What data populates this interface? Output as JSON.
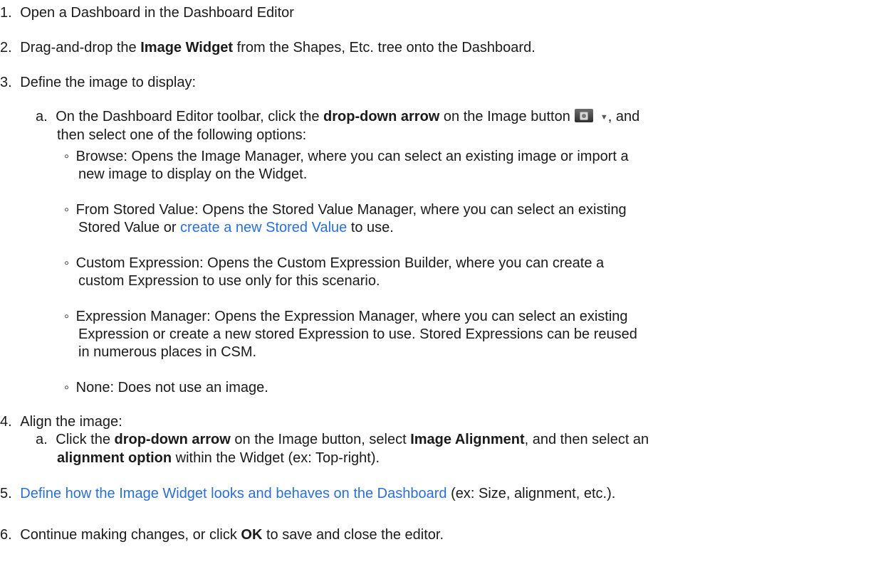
{
  "steps": {
    "s1": {
      "num": "1.",
      "text": "Open a Dashboard in the Dashboard Editor"
    },
    "s2": {
      "num": "2.",
      "pre": "Drag-and-drop the ",
      "bold": "Image Widget",
      "post": " from the Shapes, Etc. tree onto the Dashboard."
    },
    "s3": {
      "num": "3.",
      "text": "Define the image to display:",
      "a": {
        "letter": "a.",
        "pre": "On the Dashboard Editor toolbar, click the ",
        "bold": "drop-down arrow",
        "mid": " on the Image button",
        "post": ", and",
        "line2": "then select one of the following options:",
        "icon": "camera-icon",
        "arrow_icon": "dropdown-arrow-icon",
        "options": {
          "browse": {
            "line1": "Browse: Opens the Image Manager, where you can select an existing image or import a",
            "line2": "new image to display on the Widget."
          },
          "stored": {
            "line1": "From Stored Value: Opens the Stored Value Manager, where you can select an existing",
            "line2_pre": "Stored Value or ",
            "line2_link": "create a new Stored Value",
            "line2_post": " to use."
          },
          "custom": {
            "line1": "Custom Expression: Opens the Custom Expression Builder, where you can create a",
            "line2": "custom Expression to use only for this scenario."
          },
          "manager": {
            "line1": "Expression Manager: Opens the Expression Manager, where you can select an existing",
            "line2": "Expression or create a new stored Expression to use. Stored Expressions can be reused",
            "line3": "in numerous places in CSM."
          },
          "none": {
            "line1": "None: Does not use an image."
          }
        }
      }
    },
    "s4": {
      "num": "4.",
      "text": "Align the image:",
      "a": {
        "letter": "a.",
        "pre": "Click the ",
        "bold1": "drop-down arrow",
        "mid1": " on the Image button, select ",
        "bold2": "Image Alignment",
        "post1": ", and then select an",
        "bold3": "alignment option",
        "post2": " within the Widget (ex: Top-right)."
      }
    },
    "s5": {
      "num": "5.",
      "link": "Define how the Image Widget looks and behaves on the Dashboard",
      "post": " (ex: Size, alignment, etc.)."
    },
    "s6": {
      "num": "6.",
      "pre": "Continue making changes, or click ",
      "bold": "OK",
      "post": " to save and close the editor."
    }
  },
  "bullet": "◦"
}
